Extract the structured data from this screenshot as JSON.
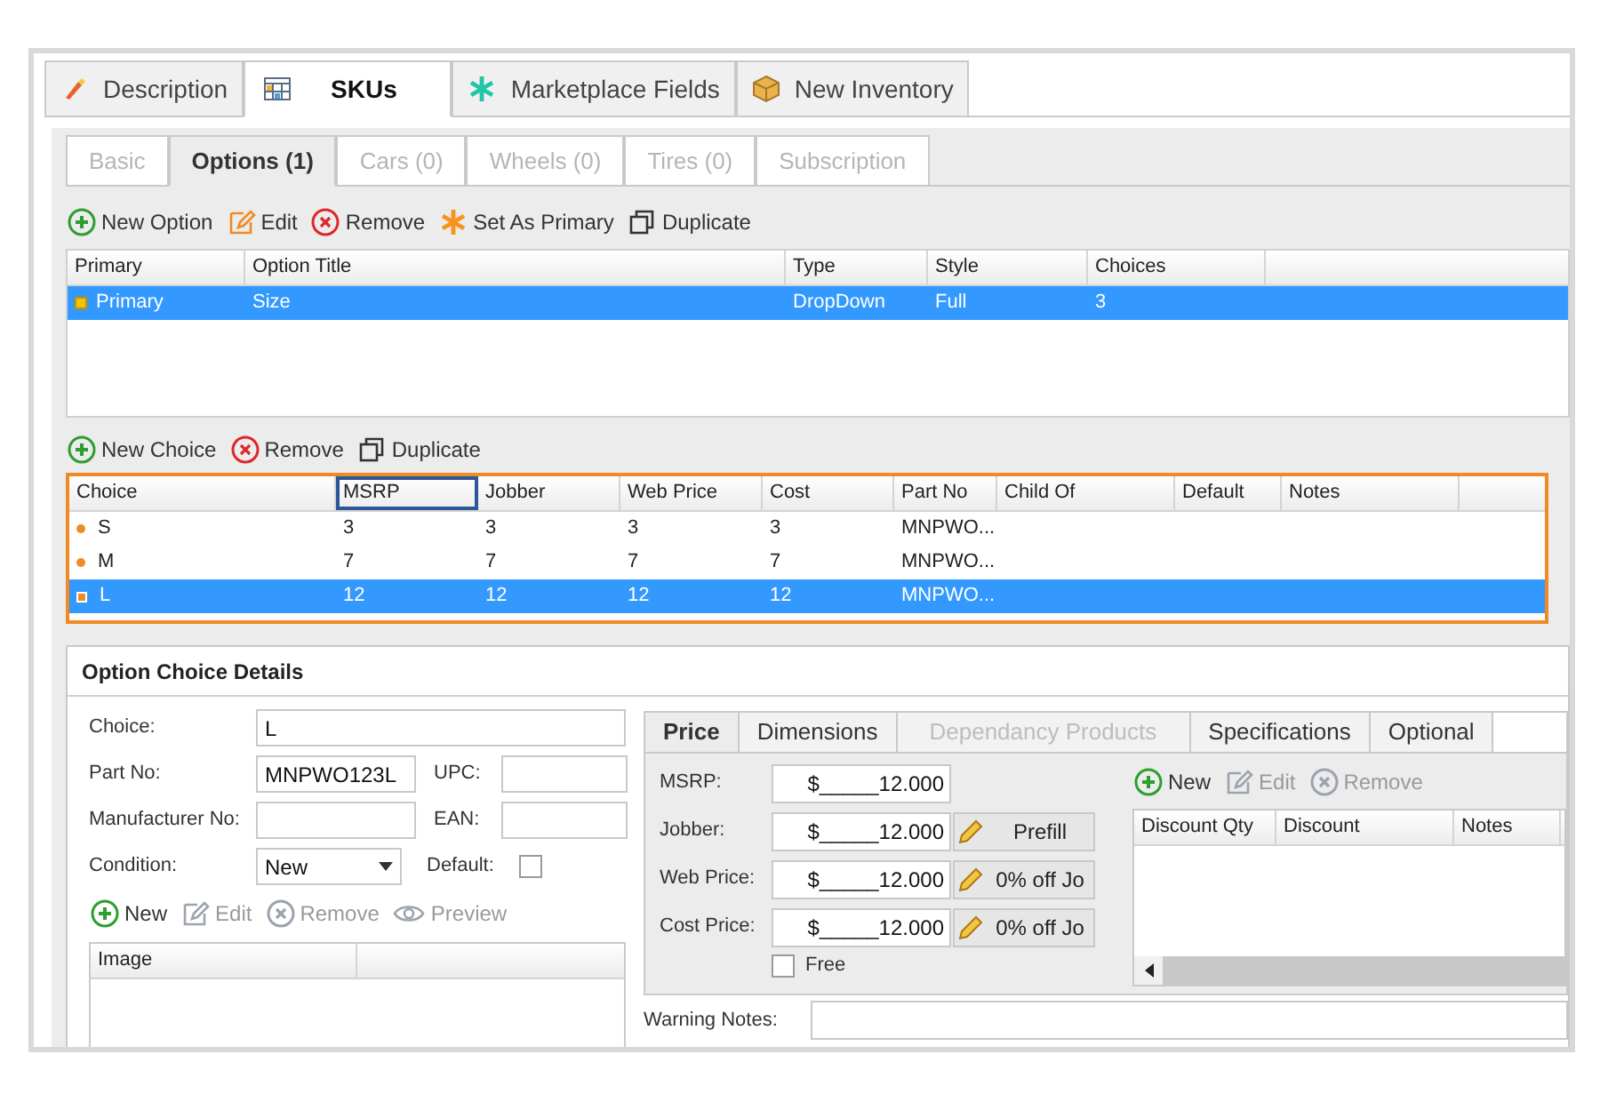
{
  "main_tabs": [
    {
      "label": "Description",
      "kind": "brush",
      "selected": false
    },
    {
      "label": "SKUs",
      "kind": "grid",
      "selected": true
    },
    {
      "label": "Marketplace Fields",
      "kind": "asterisk",
      "selected": false
    },
    {
      "label": "New Inventory",
      "kind": "box",
      "selected": false
    }
  ],
  "sub_tabs": [
    {
      "label": "Basic",
      "selected": false,
      "disabled": true
    },
    {
      "label": "Options (1)",
      "selected": true,
      "disabled": false
    },
    {
      "label": "Cars (0)",
      "selected": false,
      "disabled": true
    },
    {
      "label": "Wheels (0)",
      "selected": false,
      "disabled": true
    },
    {
      "label": "Tires (0)",
      "selected": false,
      "disabled": true
    },
    {
      "label": "Subscription",
      "selected": false,
      "disabled": true
    }
  ],
  "option_toolbar": [
    {
      "label": "New Option",
      "kind": "add",
      "disabled": false
    },
    {
      "label": "Edit",
      "kind": "edit",
      "disabled": false
    },
    {
      "label": "Remove",
      "kind": "remove",
      "disabled": false
    },
    {
      "label": "Set As Primary",
      "kind": "star",
      "disabled": false
    },
    {
      "label": "Duplicate",
      "kind": "duplicate",
      "disabled": false
    }
  ],
  "options_table": {
    "columns": [
      "Primary",
      "Option Title",
      "Type",
      "Style",
      "Choices"
    ],
    "rows": [
      {
        "cells": [
          "Primary",
          "Size",
          "DropDown",
          "Full",
          "3"
        ],
        "selected": true
      }
    ]
  },
  "choice_toolbar": [
    {
      "label": "New Choice",
      "kind": "add",
      "disabled": false
    },
    {
      "label": "Remove",
      "kind": "remove",
      "disabled": false
    },
    {
      "label": "Duplicate",
      "kind": "duplicate",
      "disabled": false
    }
  ],
  "choices_table": {
    "columns": [
      "Choice",
      "MSRP",
      "Jobber",
      "Web Price",
      "Cost",
      "Part No",
      "Child Of",
      "Default",
      "Notes"
    ],
    "rows": [
      {
        "cells": [
          "S",
          "3",
          "3",
          "3",
          "3",
          "MNPWO..."
        ],
        "selected": false
      },
      {
        "cells": [
          "M",
          "7",
          "7",
          "7",
          "7",
          "MNPWO..."
        ],
        "selected": false
      },
      {
        "cells": [
          "L",
          "12",
          "12",
          "12",
          "12",
          "MNPWO..."
        ],
        "selected": true
      }
    ]
  },
  "details": {
    "title": "Option Choice Details",
    "choice": {
      "label": "Choice:",
      "value": "L"
    },
    "part_no": {
      "label": "Part No:",
      "value": "MNPWO123L"
    },
    "upc": {
      "label": "UPC:"
    },
    "manufacturer_no": {
      "label": "Manufacturer No:"
    },
    "ean": {
      "label": "EAN:"
    },
    "condition": {
      "label": "Condition:",
      "value": "New"
    },
    "default": {
      "label": "Default:",
      "checked": false
    },
    "image_toolbar": [
      {
        "label": "New",
        "kind": "add",
        "disabled": false
      },
      {
        "label": "Edit",
        "kind": "edit",
        "disabled": true
      },
      {
        "label": "Remove",
        "kind": "remove",
        "disabled": true
      },
      {
        "label": "Preview",
        "kind": "preview",
        "disabled": true
      }
    ],
    "image_table": {
      "columns": [
        "Image"
      ]
    }
  },
  "price_tabs": [
    {
      "label": "Price",
      "selected": true,
      "disabled": false
    },
    {
      "label": "Dimensions",
      "selected": false,
      "disabled": false
    },
    {
      "label": "Dependancy Products",
      "selected": false,
      "disabled": true
    },
    {
      "label": "Specifications",
      "selected": false,
      "disabled": false
    },
    {
      "label": "Optional",
      "selected": false,
      "disabled": false
    }
  ],
  "prices": [
    {
      "label": "MSRP:",
      "value": "$_____12.000"
    },
    {
      "label": "Jobber:",
      "value": "$_____12.000",
      "button": "Prefill"
    },
    {
      "label": "Web Price:",
      "value": "$_____12.000",
      "button": "0% off Jo"
    },
    {
      "label": "Cost Price:",
      "value": "$_____12.000",
      "button": "0% off Jo"
    }
  ],
  "free": {
    "label": "Free",
    "checked": false
  },
  "discount_toolbar": [
    {
      "label": "New",
      "kind": "add",
      "disabled": false
    },
    {
      "label": "Edit",
      "kind": "edit",
      "disabled": true
    },
    {
      "label": "Remove",
      "kind": "remove",
      "disabled": true
    }
  ],
  "discount_table": {
    "columns": [
      "Discount Qty",
      "Discount",
      "Notes"
    ]
  },
  "warning_notes": {
    "label": "Warning Notes:"
  }
}
